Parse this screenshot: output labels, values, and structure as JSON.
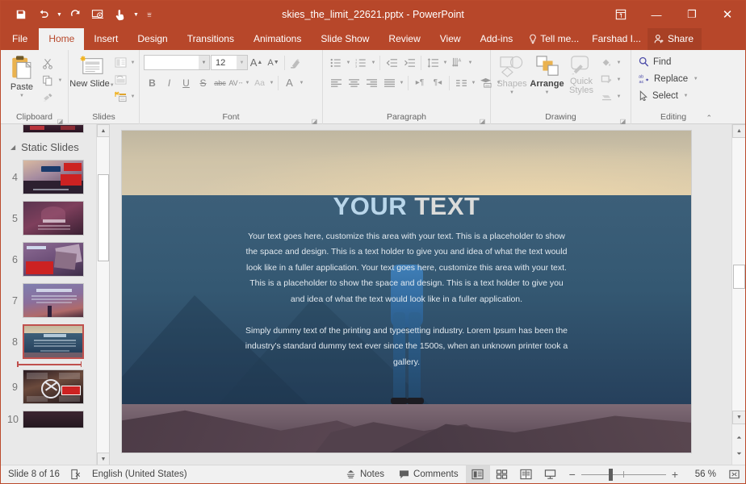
{
  "window": {
    "title": "skies_the_limit_22621.pptx - PowerPoint",
    "quick_access": [
      {
        "name": "save-icon",
        "glyph": "save"
      },
      {
        "name": "undo-icon",
        "glyph": "undo"
      },
      {
        "name": "redo-icon",
        "glyph": "redo"
      },
      {
        "name": "start-from-beginning-icon",
        "glyph": "present"
      },
      {
        "name": "touch-mouse-mode-icon",
        "glyph": "touch"
      },
      {
        "name": "customize-quick-access-toolbar-icon",
        "glyph": "more"
      }
    ],
    "controls": {
      "ribbon_display_options": "⬓",
      "minimize": "—",
      "restore": "❐",
      "close": "✕"
    },
    "accent_color": "#b7472a"
  },
  "tabs": [
    {
      "label": "File",
      "active": false
    },
    {
      "label": "Home",
      "active": true
    },
    {
      "label": "Insert",
      "active": false
    },
    {
      "label": "Design",
      "active": false
    },
    {
      "label": "Transitions",
      "active": false
    },
    {
      "label": "Animations",
      "active": false
    },
    {
      "label": "Slide Show",
      "active": false
    },
    {
      "label": "Review",
      "active": false
    },
    {
      "label": "View",
      "active": false
    },
    {
      "label": "Add-ins",
      "active": false
    }
  ],
  "tellme": "Tell me...",
  "account": "Farshad I...",
  "share": "Share",
  "ribbon": {
    "clipboard": {
      "name": "Clipboard",
      "paste": "Paste",
      "cut": "cut-icon",
      "copy": "copy-icon",
      "format_painter": "format-painter-icon"
    },
    "slides": {
      "name": "Slides",
      "new_slide": "New Slide",
      "layout": "layout-icon",
      "reset": "reset-icon",
      "section": "section-icon"
    },
    "font": {
      "name": "Font",
      "font_name": "",
      "font_name_placeholder": "",
      "font_size": "12",
      "increase_size": "A",
      "decrease_size": "A",
      "clear_formatting": "clear-formatting-icon",
      "bold": "B",
      "italic": "I",
      "underline": "U",
      "shadow": "S",
      "strikethrough": "abc",
      "character_spacing": "AV",
      "change_case": "Aa",
      "font_color": "A"
    },
    "paragraph": {
      "name": "Paragraph"
    },
    "drawing": {
      "name": "Drawing",
      "shapes": "Shapes",
      "arrange": "Arrange",
      "quick_styles": "Quick Styles",
      "shape_fill": "shape-fill-icon",
      "shape_outline": "shape-outline-icon",
      "shape_effects": "shape-effects-icon"
    },
    "editing": {
      "name": "Editing",
      "find": "Find",
      "replace": "Replace",
      "select": "Select"
    },
    "collapse_ribbon": "collapse-ribbon-icon"
  },
  "thumbnails": {
    "section_label": "Static Slides",
    "slides": [
      {
        "number": "",
        "selected": false,
        "style": "top-partial"
      },
      {
        "number": "4",
        "selected": false,
        "style": "s4"
      },
      {
        "number": "5",
        "selected": false,
        "style": "s5"
      },
      {
        "number": "6",
        "selected": false,
        "style": "s6"
      },
      {
        "number": "7",
        "selected": false,
        "style": "s7"
      },
      {
        "number": "8",
        "selected": true,
        "style": "s8"
      },
      {
        "number": "9",
        "selected": false,
        "style": "s9"
      },
      {
        "number": "10",
        "selected": false,
        "style": "s10"
      }
    ]
  },
  "slide": {
    "title_part1": "YOUR",
    "title_part2": "TEXT",
    "paragraph1": "Your text goes here, customize this area with your text. This is a placeholder to show the space and design. This is a text holder to give you and idea of what the text would look like in a fuller application. Your text goes here, customize this area with your text. This is a placeholder to show the space and design. This is a text holder to give you and idea of what the text would look like in a fuller application.",
    "paragraph2": "Simply dummy text of the printing and typesetting industry. Lorem Ipsum has been the industry's standard dummy text ever since the 1500s, when an unknown printer took a gallery.",
    "title_color_1": "#b9d6ea",
    "title_color_2": "#dcdcda"
  },
  "status_bar": {
    "slide_counter": "Slide 8 of 16",
    "accessibility_icon": "spell-check-icon",
    "language": "English (United States)",
    "notes": "Notes",
    "comments": "Comments",
    "views": [
      {
        "name": "normal-view-button",
        "active": true
      },
      {
        "name": "slide-sorter-view-button",
        "active": false
      },
      {
        "name": "reading-view-button",
        "active": false
      },
      {
        "name": "slide-show-button",
        "active": false
      }
    ],
    "zoom_out": "−",
    "zoom_in": "+",
    "zoom_level": "56 %",
    "fit_slide": "fit-to-window-icon"
  }
}
